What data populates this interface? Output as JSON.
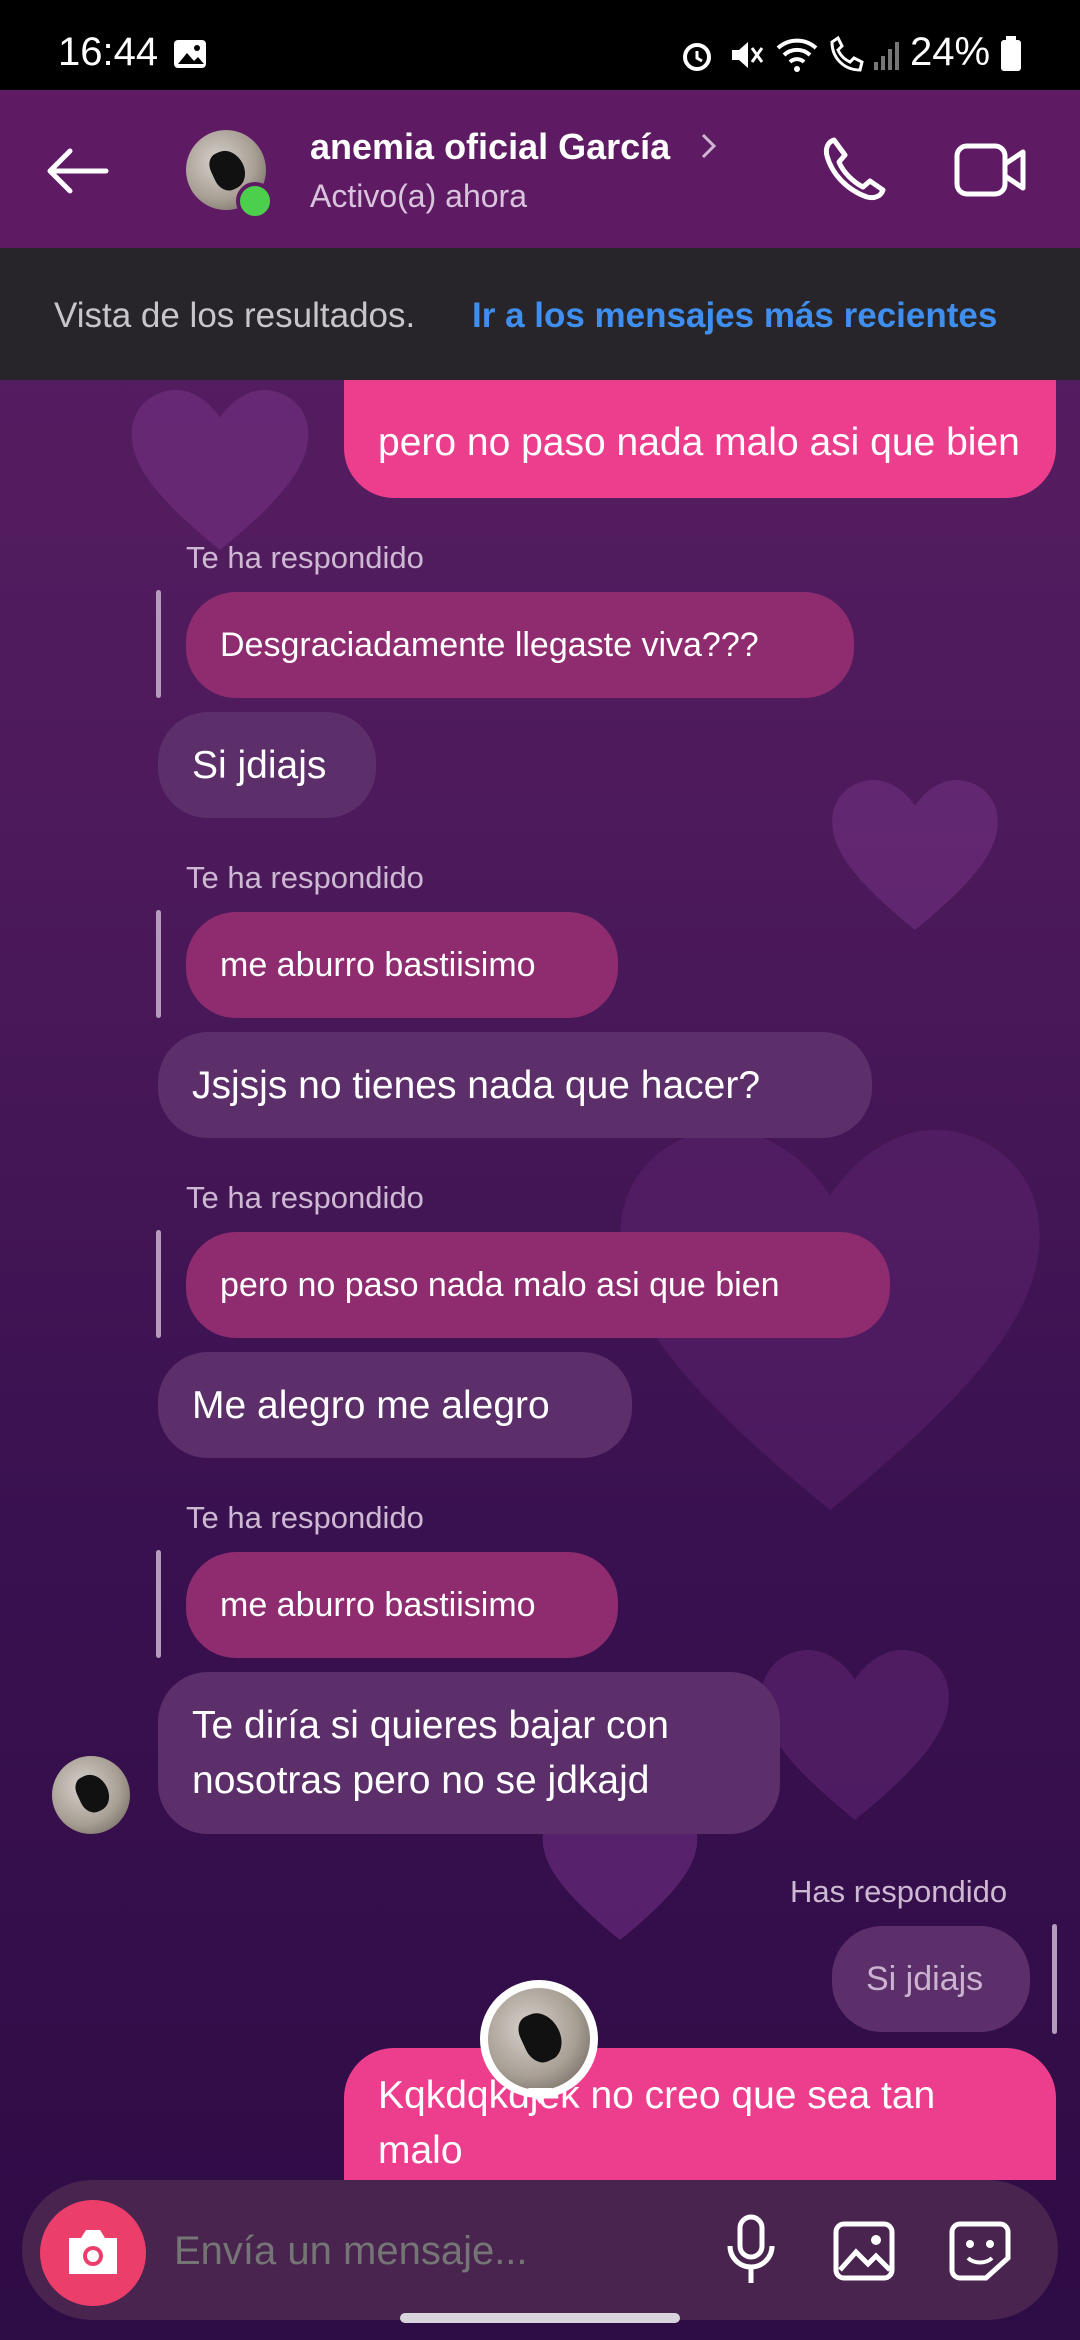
{
  "status_bar": {
    "time": "16:44",
    "battery": "24%"
  },
  "header": {
    "contact_name": "anemia oficial García",
    "status": "Activo(a) ahora"
  },
  "banner": {
    "text": "Vista de los resultados.",
    "link": "Ir a los mensajes más recientes"
  },
  "messages": {
    "m1": "pero no paso nada malo asi que bien",
    "reply_label_them": "Te ha respondido",
    "q1": "Desgraciadamente llegaste viva???",
    "t1": "Si jdiajs",
    "q2": "me aburro bastiisimo",
    "t2": "Jsjsjs no tienes nada que hacer?",
    "q3": "pero no paso nada malo asi que bien",
    "t3": "Me alegro me alegro",
    "q4": "me aburro bastiisimo",
    "t4": "Te diría si quieres bajar con nosotras pero no se jdkajd",
    "reply_label_me": "Has respondido",
    "q5": "Si jdiajs",
    "m2": "Kqkdqkdjek no creo que sea tan malo"
  },
  "composer": {
    "placeholder": "Envía un mensaje..."
  },
  "colors": {
    "header": "#5e1a63",
    "my_bubble": "#ec3e8c",
    "their_bubble": "#5c2f6a",
    "quoted_bubble": "#8f2b6f",
    "link": "#3f8ff0",
    "camera": "#ec3e6a"
  },
  "icons": [
    "back-arrow-icon",
    "chevron-right-icon",
    "phone-icon",
    "video-icon",
    "camera-icon",
    "microphone-icon",
    "gallery-icon",
    "sticker-icon",
    "alarm-icon",
    "mute-icon",
    "wifi-icon",
    "battery-icon"
  ]
}
